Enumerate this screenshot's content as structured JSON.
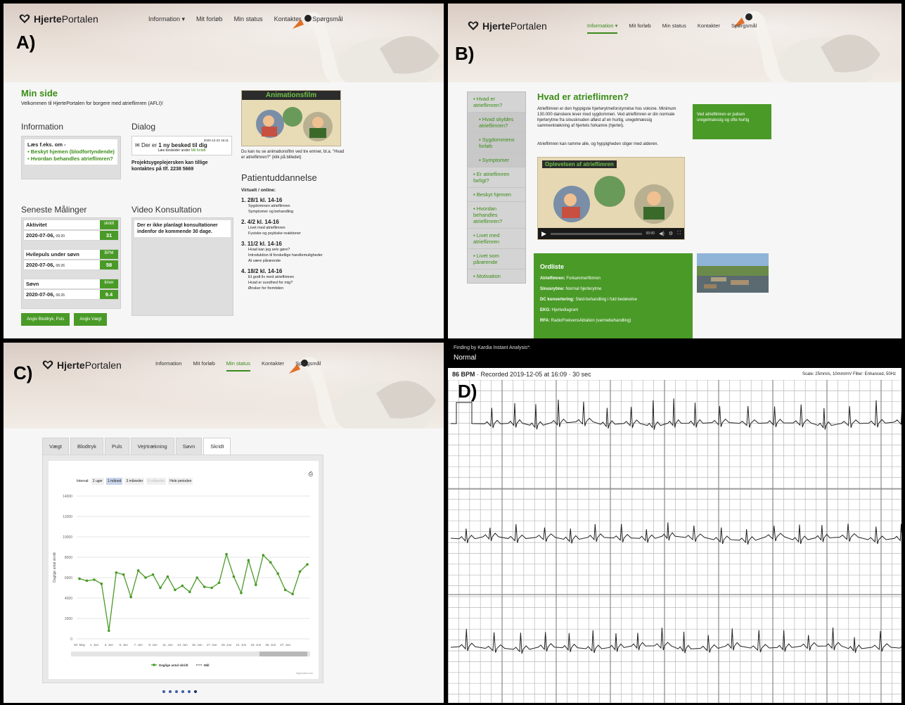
{
  "site": {
    "brand_bold": "Hjerte",
    "brand_rest": "Portalen",
    "brand_color": "#3b8d17"
  },
  "nav_A": [
    "Information ▾",
    "Mit forløb",
    "Min status",
    "Kontakter",
    "Spørgsmål"
  ],
  "nav_B": [
    "Information ▾",
    "Mit forløb",
    "Min status",
    "Kontakter",
    "Spørgsmål"
  ],
  "nav_C": [
    "Information",
    "Mit forløb",
    "Min status",
    "Kontakter",
    "Spørgsmål"
  ],
  "letters": {
    "a": "A)",
    "b": "B)",
    "c": "C)",
    "d": "D)"
  },
  "panelA": {
    "title": "Min side",
    "welcome": "Velkommen til HjertePortalen for borgere med atrieflimren (AFLI)!",
    "info_heading": "Information",
    "info_lead": "Læs f.eks. om -",
    "info_links": [
      "Beskyt hjemen (blodfortyndende)",
      "Hvordan behandles atrieflimren?"
    ],
    "dialog_heading": "Dialog",
    "dialog_date": "2020-12-22 16:11",
    "dialog_msg_pre": "Der er",
    "dialog_msg_bold": "1 ny besked til dig",
    "dialog_sub_pre": "Læs beskeder under",
    "dialog_sub_link": "Mit forløb",
    "nurse_text": "Projektsygeplejersken kan tillige kontaktes på tlf. 2238 5669",
    "film_title": "Animationsfilm",
    "film_caption": "Du kan nu se animationsfilm ved tre emner, bl.a. \"Hvad er atrieflimren?\" (klik på billedet)",
    "measure_heading": "Seneste Målinger",
    "measures": [
      {
        "label": "Aktivitet",
        "unit": "skridt",
        "date": "2020-07-06,",
        "time": "09:20",
        "value": "31"
      },
      {
        "label": "Hvilepuls under søvn",
        "unit": "BPM",
        "date": "2020-07-06,",
        "time": "06:26",
        "value": "58"
      },
      {
        "label": "Søvn",
        "unit": "timer",
        "date": "2020-07-06,",
        "time": "06:26",
        "value": "9.4"
      }
    ],
    "btn_bp": "Angiv Blodtryk, Puls",
    "btn_weight": "Angiv Vægt",
    "video_heading": "Video Konsultation",
    "video_text": "Der er ikke planlagt konsultationer indenfor de kommende 30 dage.",
    "edu_heading": "Patientuddannelse",
    "edu_sub": "Virtuelt / online:",
    "edu": [
      {
        "date": "28/1 kl. 14-16",
        "topics": [
          "Sygdommen atrieflimren",
          "Symptomer og behandling"
        ]
      },
      {
        "date": "4/2 kl. 14-16",
        "topics": [
          "Livet med atrieflimren",
          "Fysiske og psykiske reaktioner"
        ]
      },
      {
        "date": "11/2 kl. 14-16",
        "topics": [
          "Hvad kan jeg selv gøre?",
          "Introduktion til forskellige handlemuligheder",
          "At være pårørende"
        ]
      },
      {
        "date": "18/2 kl. 14-16",
        "topics": [
          "Et godt liv med atrieflimren",
          "Hvad er sundhed for mig?",
          "Ønsker for fremtiden"
        ]
      }
    ]
  },
  "panelB": {
    "side": [
      {
        "label": "Hvad er atrieflimren?",
        "sub": false
      },
      {
        "label": "Hvad skyldes atrieflimren?",
        "sub": true
      },
      {
        "label": "Sygdommens forløb",
        "sub": true
      },
      {
        "label": "Symptomer",
        "sub": true
      },
      {
        "label": "Er atrieflimren farligt?",
        "sub": false
      },
      {
        "label": "Beskyt hjemen",
        "sub": false
      },
      {
        "label": "Hvordan behandles atrieflimren?",
        "sub": false
      },
      {
        "label": "Livet med atrieflimren",
        "sub": false
      },
      {
        "label": "Livet som pårørende",
        "sub": false
      },
      {
        "label": "Motivation",
        "sub": false
      }
    ],
    "title": "Hvad er atrieflimren?",
    "p1": "Atrieflimren er den hyppigste hjerterytmeforstyrrelse hos voksne. Minimum 130.000 danskere lever med sygdommen. Ved atrieflimren er din normale hjerterytme fra sinusknuden afløst af en hurtig, uregelmæssig sammentrækning af hjertets forkamre (hjertet).",
    "p2": "Atrieflimren kan ramme alle, og hyppigheden stiger med alderen.",
    "callout": "Ved atrieflimren er pulsen uregelmæssig og ofte hurtig",
    "video_title": "Oplevelsen af atrieflimren",
    "video_time": "00:00",
    "glossary_title": "Ordliste",
    "glossary": [
      {
        "term": "Atrieflimren:",
        "def": "Forkammerflimren"
      },
      {
        "term": "Sinusrytme:",
        "def": "Normal hjerterytme"
      },
      {
        "term": "DC konvertering:",
        "def": "Stød-behandling i fuld bedøvelse"
      },
      {
        "term": "EKG:",
        "def": "Hjertediagram"
      },
      {
        "term": "RFA:",
        "def": "RadioFrekvensAblation (varmebehandling)"
      }
    ]
  },
  "panelC": {
    "tabs": [
      "Vægt",
      "Blodtryk",
      "Puls",
      "Vejrtrækning",
      "Søvn",
      "Skridt"
    ],
    "active_tab": "Skridt",
    "interval_label": "Interval:",
    "ranges": [
      "2 uger",
      "1 måned",
      "3 måneder",
      "6 måneder",
      "Hele perioden"
    ],
    "legend_series": "Daglige antal skridt",
    "legend_goal": "Mål",
    "credits": "Highcharts.com"
  },
  "chart_data": {
    "type": "line",
    "title": "",
    "xlabel": "",
    "ylabel": "Daglige antal skridt",
    "ylim": [
      0,
      14000
    ],
    "yticks": [
      0,
      2000,
      4000,
      6000,
      8000,
      10000,
      12000,
      14000
    ],
    "xtick_labels": [
      "30. May",
      "1. Jun",
      "3. Jun",
      "5. Jun",
      "7. Jun",
      "9. Jun",
      "11. Jun",
      "13. Jun",
      "15. Jun",
      "17. Jun",
      "19. Jun",
      "21. Jun",
      "23. Jun",
      "25. Jun",
      "27. Jun"
    ],
    "series": [
      {
        "name": "Daglige antal skridt",
        "color": "#4a9a28",
        "values": [
          5900,
          5700,
          5800,
          5400,
          800,
          6500,
          6300,
          4100,
          6700,
          6000,
          6300,
          5000,
          6100,
          4800,
          5200,
          4600,
          6000,
          5100,
          5000,
          5500,
          8300,
          6100,
          4500,
          7700,
          5300,
          8200,
          7500,
          6400,
          4800,
          4400,
          6600,
          7300
        ]
      }
    ]
  },
  "panelD": {
    "finding_label": "Finding by Kardia Instant Analysis*:",
    "finding": "Normal",
    "bpm": "86 BPM",
    "recorded": "· Recorded 2019-12-05 at 16:09 · 30 sec",
    "scale": "Scale: 25mm/s, 10mm/mV  Filter: Enhanced, 50Hz",
    "grid_color": "#b8b8b8"
  }
}
